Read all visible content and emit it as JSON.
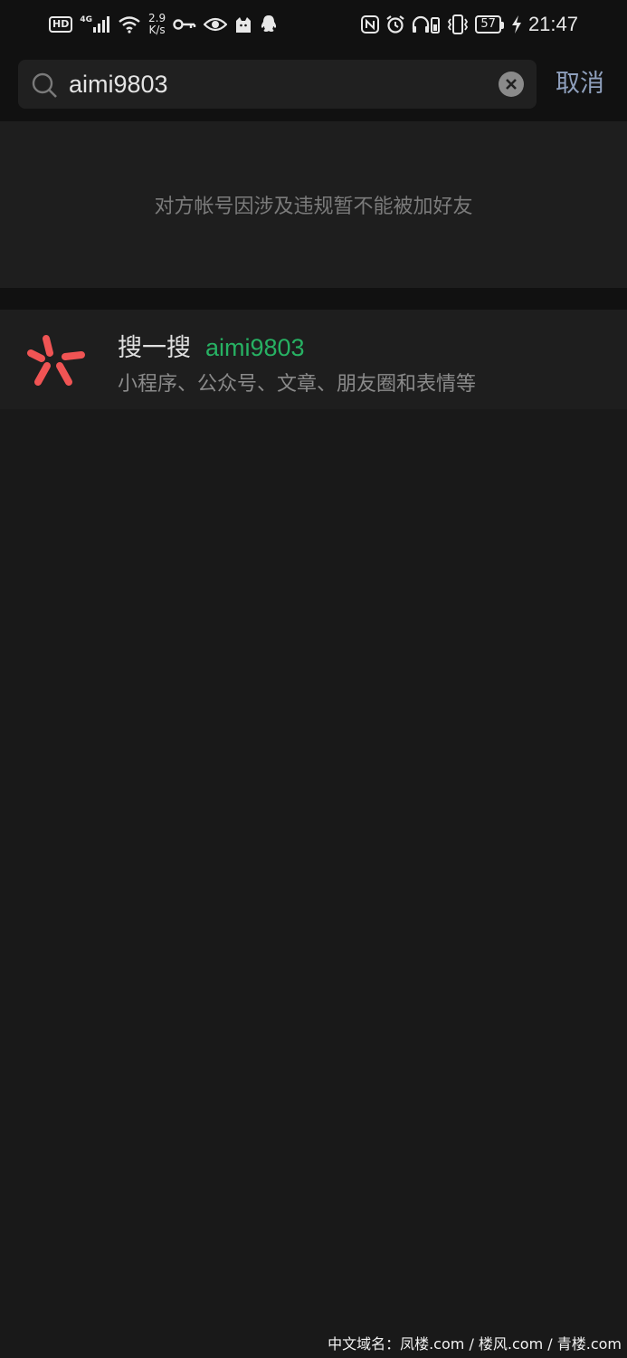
{
  "status_bar": {
    "hd": "HD",
    "network": "4G",
    "speed_value": "2.9",
    "speed_unit": "K/s",
    "battery": "57",
    "time": "21:47"
  },
  "search": {
    "query": "aimi9803",
    "cancel_label": "取消"
  },
  "notice": {
    "message": "对方帐号因涉及违规暂不能被加好友"
  },
  "souyisou": {
    "title": "搜一搜",
    "keyword": "aimi9803",
    "subtitle": "小程序、公众号、文章、朋友圈和表情等",
    "logo_color": "#f05454"
  },
  "watermark": {
    "text": "中文域名：凤楼.com / 楼风.com / 青楼.com"
  },
  "colors": {
    "background": "#191919",
    "keyword_green": "#27b163",
    "cancel_blue": "#8fa0bd"
  }
}
